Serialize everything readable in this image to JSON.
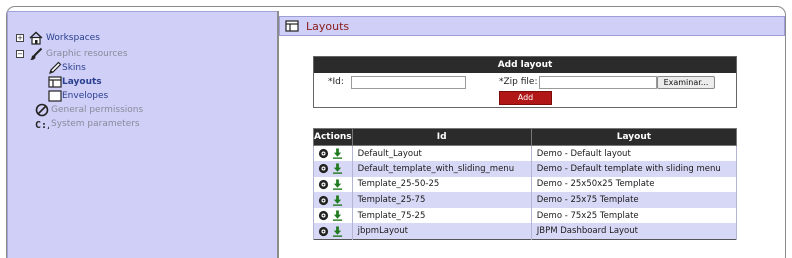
{
  "sidebar": {
    "workspaces": "Workspaces",
    "graphic_resources": "Graphic resources",
    "skins": "Skins",
    "layouts": "Layouts",
    "envelopes": "Envelopes",
    "general_permissions": "General permissions",
    "system_parameters": "System parameters",
    "toggle_expand": "+",
    "toggle_collapse": "−"
  },
  "page": {
    "title": "Layouts"
  },
  "add_form": {
    "header": "Add layout",
    "id_label": "*Id:",
    "id_value": "",
    "zip_label": "*Zip file:",
    "zip_value": "",
    "browse_label": "Examinar...",
    "add_label": "Add"
  },
  "table": {
    "columns": [
      "Actions",
      "Id",
      "Layout"
    ],
    "rows": [
      {
        "id": "Default_Layout",
        "layout": "Demo - Default layout"
      },
      {
        "id": "Default_template_with_sliding_menu",
        "layout": "Demo - Default template with sliding menu"
      },
      {
        "id": "Template_25-50-25",
        "layout": "Demo - 25x50x25 Template"
      },
      {
        "id": "Template_25-75",
        "layout": "Demo - 25x75 Template"
      },
      {
        "id": "Template_75-25",
        "layout": "Demo - 75x25 Template"
      },
      {
        "id": "jbpmLayout",
        "layout": "JBPM Dashboard Layout"
      }
    ]
  },
  "colors": {
    "sidebar_bg": "#cfcff7",
    "title_text": "#8b1a1a",
    "header_bg": "#2b2b2b",
    "row_alt": "#d7d7f6",
    "add_button": "#b11717",
    "link_blue": "#2a3f8f",
    "link_gray": "#8a8a9a"
  },
  "icons": {
    "view": "eye-icon",
    "download": "download-icon",
    "home": "home-icon",
    "brush": "brush-icon",
    "pencil": "pencil-icon",
    "layout": "layout-icon",
    "envelope": "envelope-icon",
    "permission": "forbidden-icon",
    "console": "console-icon"
  }
}
